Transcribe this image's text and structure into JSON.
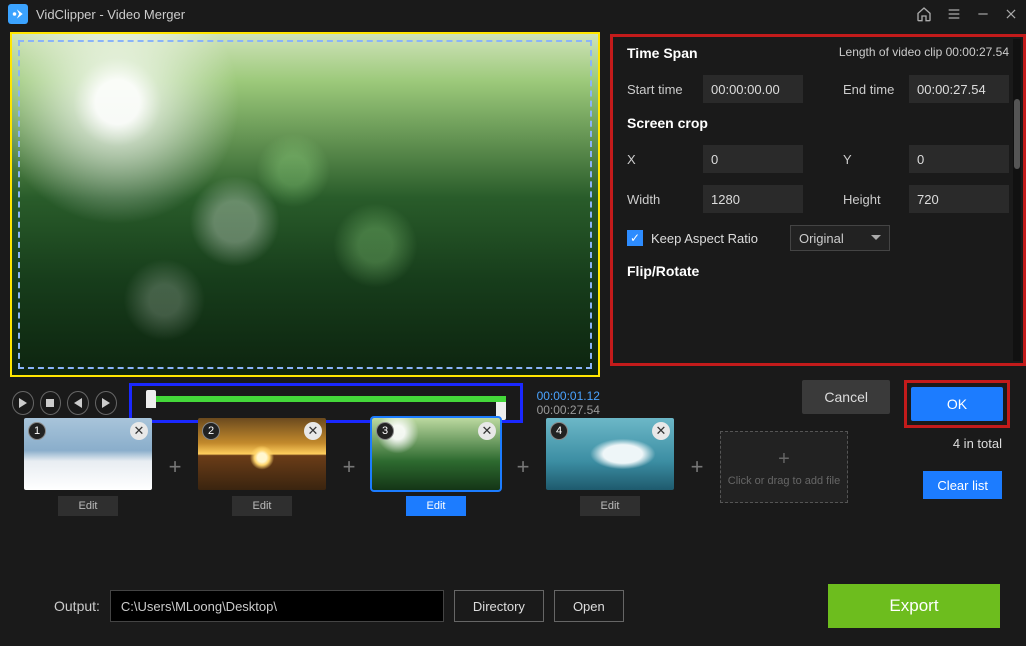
{
  "titlebar": {
    "title": "VidClipper - Video Merger"
  },
  "timeline": {
    "current": "00:00:01.12",
    "total": "00:00:27.54"
  },
  "settings": {
    "timespan_title": "Time Span",
    "length_label": "Length of video clip 00:00:27.54",
    "start_label": "Start time",
    "start_value": "00:00:00.00",
    "end_label": "End time",
    "end_value": "00:00:27.54",
    "crop_title": "Screen crop",
    "x_label": "X",
    "x_value": "0",
    "y_label": "Y",
    "y_value": "0",
    "w_label": "Width",
    "w_value": "1280",
    "h_label": "Height",
    "h_value": "720",
    "keep_ratio_label": "Keep Aspect Ratio",
    "aspect_value": "Original",
    "flip_title": "Flip/Rotate",
    "cancel": "Cancel",
    "ok": "OK"
  },
  "clips": {
    "items": [
      {
        "n": "1",
        "edit": "Edit"
      },
      {
        "n": "2",
        "edit": "Edit"
      },
      {
        "n": "3",
        "edit": "Edit"
      },
      {
        "n": "4",
        "edit": "Edit"
      }
    ],
    "add_hint": "Click or drag to add file",
    "total": "4 in total",
    "clear": "Clear list"
  },
  "output": {
    "label": "Output:",
    "path": "C:\\Users\\MLoong\\Desktop\\",
    "directory": "Directory",
    "open": "Open",
    "export": "Export"
  }
}
